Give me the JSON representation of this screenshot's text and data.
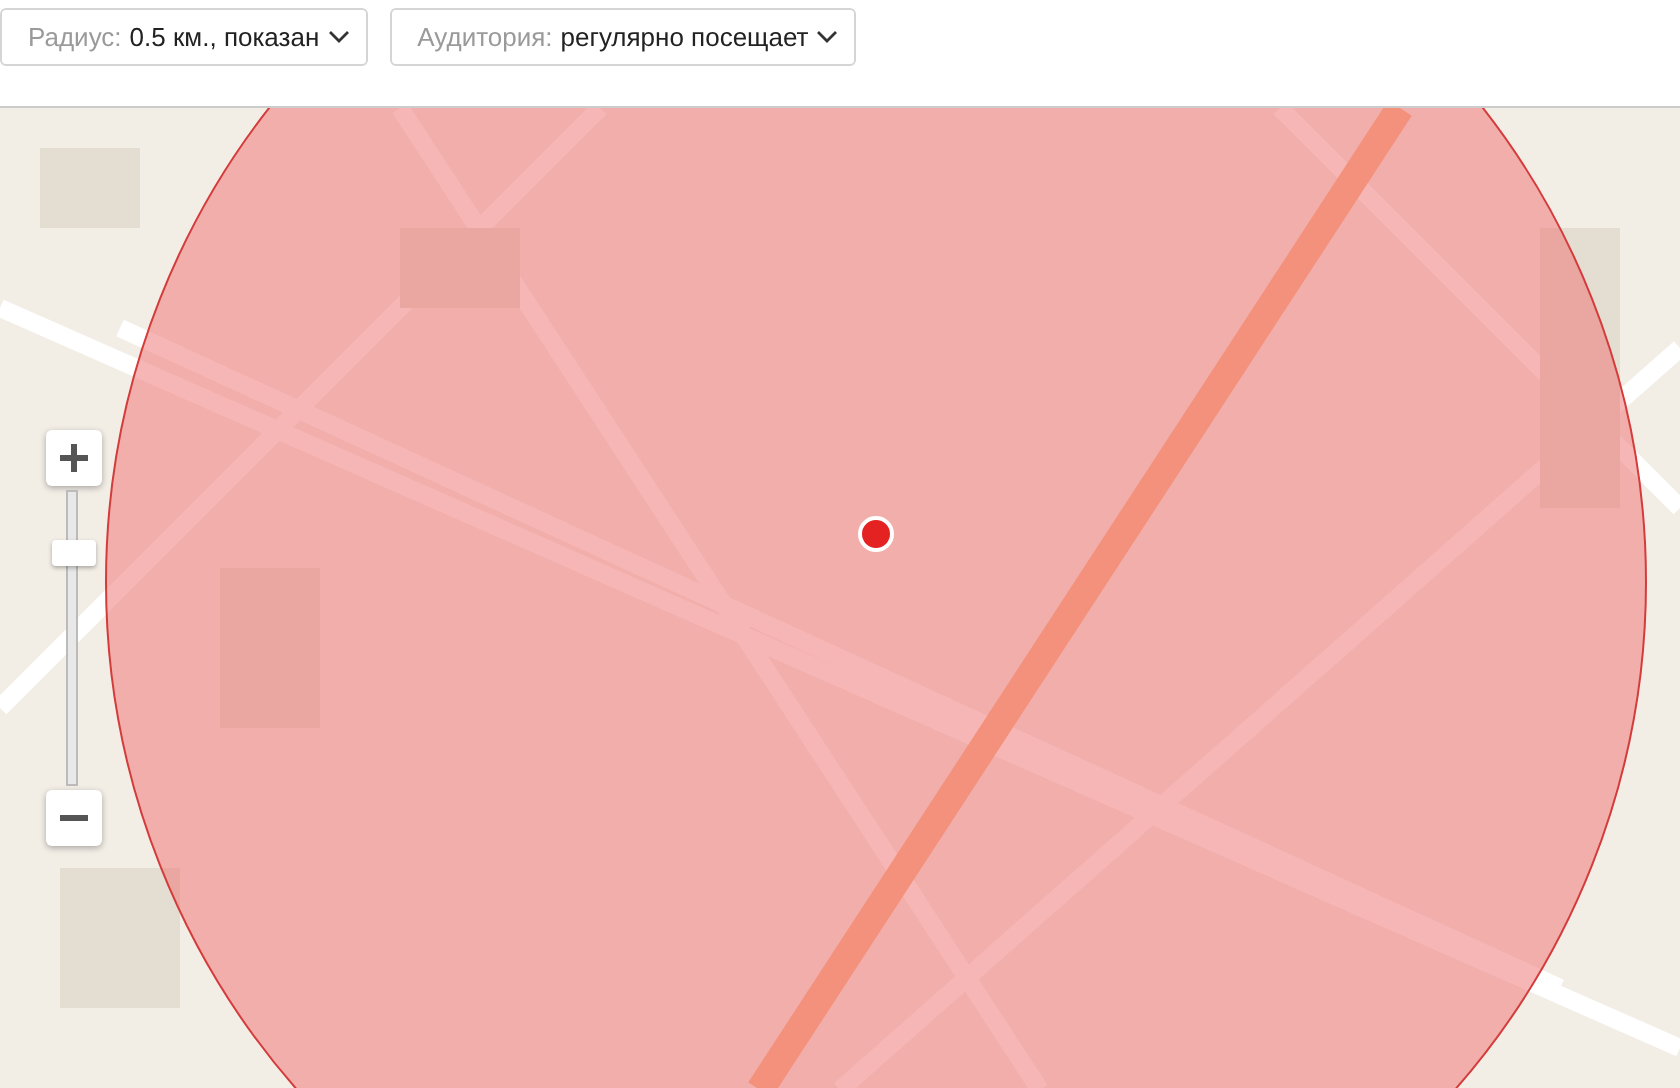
{
  "filters": [
    {
      "label": "Радиус:",
      "value": "0.5 км., показан"
    },
    {
      "label": "Аудитория:",
      "value": "регулярно посещает"
    }
  ],
  "map": {
    "zoom_slider": {
      "level": 0.86
    }
  }
}
